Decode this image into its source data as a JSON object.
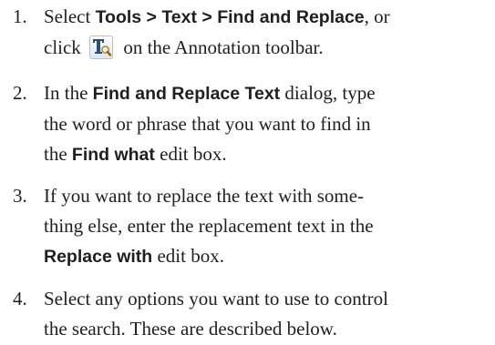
{
  "steps": [
    {
      "number": "1.",
      "lines": [
        {
          "t1": "Select ",
          "b1": "Tools > Text > Find and Replace",
          "t2": ", or"
        },
        {
          "t1": "click ",
          "t2": " on the Annotation toolbar."
        }
      ]
    },
    {
      "number": "2.",
      "lines": [
        {
          "t1": "In the ",
          "b1": "Find and Replace Text",
          "t2": " dialog, type"
        },
        {
          "t1": "the word or phrase that you want to find in"
        },
        {
          "t1": "the ",
          "b1": "Find what",
          "t2": " edit box."
        }
      ]
    },
    {
      "number": "3.",
      "lines": [
        {
          "t1": "If you want to replace the text with some-"
        },
        {
          "t1": "thing else, enter the replacement text in the"
        },
        {
          "b1": "Replace with",
          "t2": " edit box."
        }
      ]
    },
    {
      "number": "4.",
      "lines": [
        {
          "t1": "Select any options you want to use to control"
        },
        {
          "t1": "the search. These are described below."
        }
      ]
    }
  ],
  "icons": {
    "find_replace": "find-replace-icon"
  },
  "colors": {
    "text": "#1f1f1f",
    "icon_border": "#b6c2cf",
    "icon_letter": "#2b4f7a",
    "icon_lens": "#c58a1c"
  }
}
